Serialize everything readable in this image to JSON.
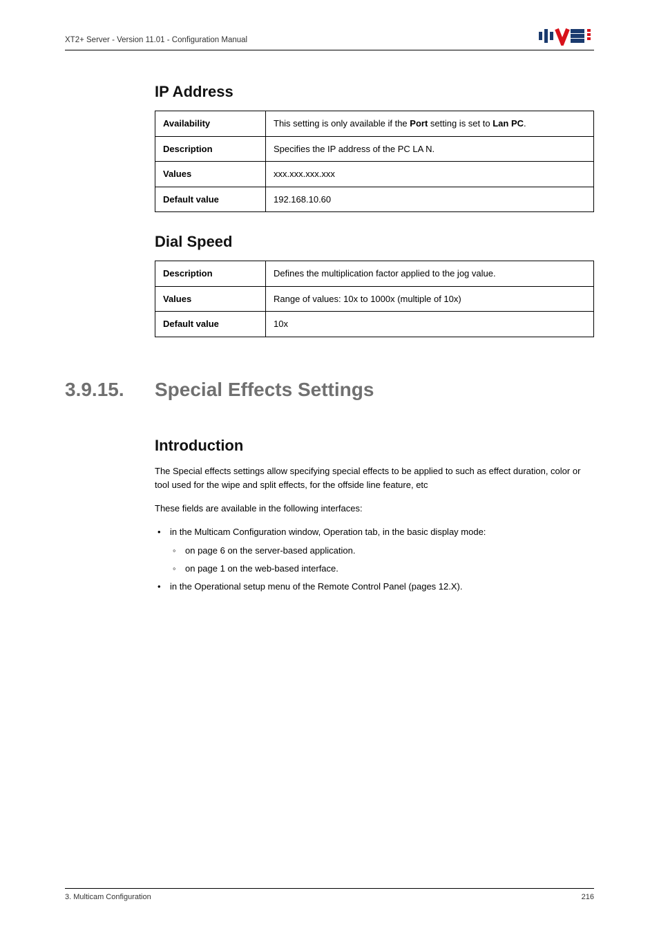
{
  "header": {
    "left": "XT2+ Server - Version 11.01 - Configuration Manual"
  },
  "ip_address": {
    "heading": "IP Address",
    "rows": {
      "availability": {
        "label": "Availability",
        "pre": "This setting is only available if the ",
        "port": "Port",
        "mid": " setting is set to ",
        "lan": "Lan PC",
        "post": "."
      },
      "description": {
        "label": "Description",
        "value": "Specifies the IP address of the PC LA N."
      },
      "values": {
        "label": "Values",
        "value": "xxx.xxx.xxx.xxx"
      },
      "default": {
        "label": "Default value",
        "value": "192.168.10.60"
      }
    }
  },
  "dial_speed": {
    "heading": "Dial Speed",
    "rows": {
      "description": {
        "label": "Description",
        "value": "Defines the multiplication factor applied to the jog value."
      },
      "values": {
        "label": "Values",
        "value": "Range of values: 10x to 1000x (multiple of 10x)"
      },
      "default": {
        "label": "Default value",
        "value": "10x"
      }
    }
  },
  "section": {
    "num": "3.9.15.",
    "title": "Special Effects Settings"
  },
  "intro": {
    "heading": "Introduction",
    "p1": "The Special effects settings allow specifying special effects to be applied to such as effect duration, color or tool used for the wipe and split effects, for the offside line feature, etc",
    "p2": "These fields are available in the following interfaces:",
    "b1": "in the Multicam Configuration window, Operation tab, in the basic display mode:",
    "b1a": "on page 6 on the server-based application.",
    "b1b": "on page 1 on the web-based interface.",
    "b2": "in the Operational setup menu of the Remote Control Panel (pages 12.X)."
  },
  "footer": {
    "left": "3. Multicam Configuration",
    "right": "216"
  }
}
